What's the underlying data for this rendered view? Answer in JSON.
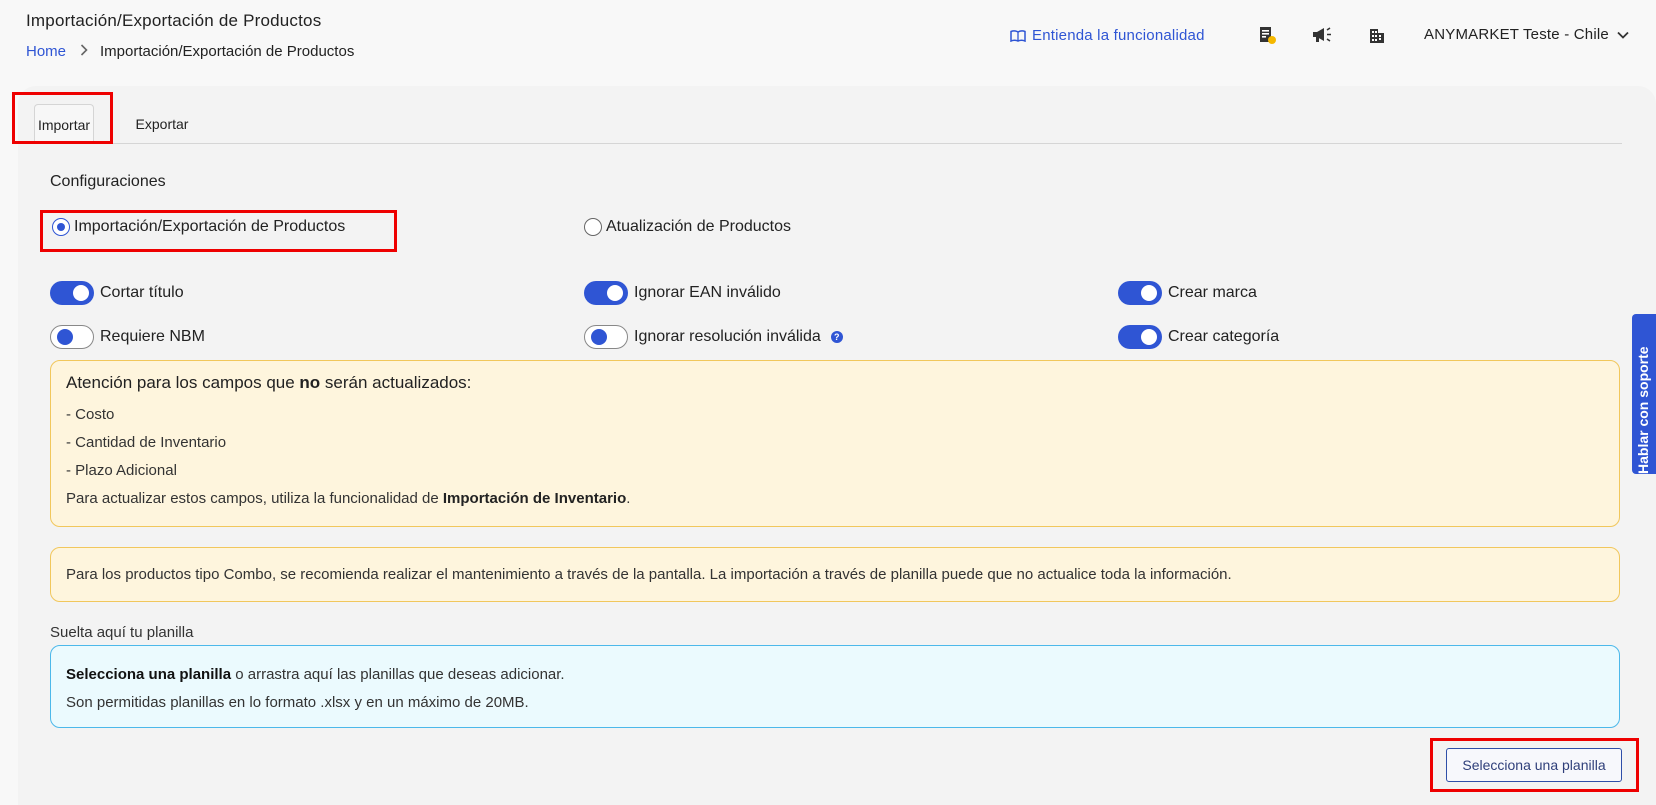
{
  "header": {
    "title": "Importación/Exportación de Productos",
    "breadcrumb": {
      "home": "Home",
      "current": "Importación/Exportación de Productos"
    },
    "help_link": "Entienda la funcionalidad",
    "account": "ANYMARKET Teste - Chile",
    "icons": [
      "receipt-icon",
      "megaphone-icon",
      "building-icon"
    ]
  },
  "tabs": [
    {
      "label": "Importar",
      "active": true
    },
    {
      "label": "Exportar",
      "active": false
    }
  ],
  "config": {
    "title": "Configuraciones",
    "radios": [
      {
        "label": "Importación/Exportación de Productos",
        "checked": true
      },
      {
        "label": "Atualización de Productos",
        "checked": false
      }
    ],
    "toggles": [
      {
        "label": "Cortar título",
        "on": true
      },
      {
        "label": "Ignorar EAN inválido",
        "on": true
      },
      {
        "label": "Crear marca",
        "on": true
      },
      {
        "label": "Requiere NBM",
        "on": false
      },
      {
        "label": "Ignorar resolución inválida",
        "on": false
      },
      {
        "label": "Crear categoría",
        "on": true
      }
    ]
  },
  "alert_fields": {
    "title_pre": "Atención para los campos que ",
    "title_bold": "no",
    "title_post": " serán actualizados:",
    "items": [
      "- Costo",
      "- Cantidad de Inventario",
      "- Plazo Adicional"
    ],
    "footer_pre": "Para actualizar estos campos, utiliza la funcionalidad de ",
    "footer_bold": "Importación de Inventario",
    "footer_post": "."
  },
  "alert_combo": "Para los productos tipo Combo, se recomienda realizar el mantenimiento a través de la pantalla. La importación a través de planilla puede que no actualice toda la información.",
  "dropzone": {
    "label": "Suelta aquí tu planilla",
    "line1_bold": "Selecciona una planilla",
    "line1_rest": " o arrastra aquí las planillas que deseas adicionar.",
    "line2": "Son permitidas planillas en lo formato .xlsx y en un máximo de 20MB."
  },
  "select_button": "Selecciona una planilla",
  "support_tab": "Hablar con soporte",
  "colors": {
    "accent": "#2f55d4",
    "highlight": "#ee0000",
    "warning_bg": "#fef5dd",
    "info_bg": "#ebfafe"
  }
}
